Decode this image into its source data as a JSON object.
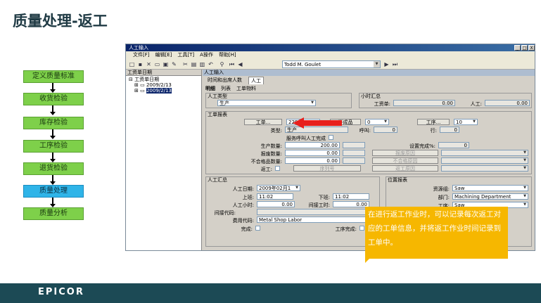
{
  "slide": {
    "title": "质量处理-返工",
    "footer_logo": "EPICOR"
  },
  "flow": {
    "steps": [
      "定义质量标准",
      "收货检验",
      "库存检验",
      "工序检验",
      "退货检验",
      "质量处理",
      "质量分析"
    ],
    "active": "质量处理"
  },
  "window": {
    "title": "人工输入",
    "controls": [
      "_",
      "□",
      "X"
    ],
    "menu": [
      "文件[F]",
      "编辑[E]",
      "工具[T]",
      "A操作",
      "帮助[H]"
    ],
    "user": "Todd M. Goulet",
    "left_header": "工资单日期",
    "tree": [
      "工资单日期",
      "2009/2/13",
      "2009/2/13"
    ],
    "main_header": "人工输入",
    "tabs": [
      "时间和出席人数",
      "人工"
    ],
    "subtabs": [
      "明细",
      "列表",
      "工单物料"
    ],
    "labor_type": {
      "label": "人工类型",
      "value": "生产"
    },
    "hour_summary": {
      "label": "小时汇总",
      "payroll_label": "工资单:",
      "payroll_value": "0.00",
      "labor_label": "人工:",
      "labor_value": "0.00"
    },
    "work_order": {
      "group": "工单报表",
      "job_btn": "工单...",
      "job_value": "2292",
      "part_btn": "半成品",
      "part_value": "0",
      "op_btn": "工序...",
      "op_value": "10",
      "type_label": "类型:",
      "type_value": "生产",
      "call_label": "呼叫:",
      "call_value": "0",
      "line_label": "行:",
      "line_value": "0",
      "service_label": "服务呼叫人工完成",
      "prod_qty_label": "生产数量:",
      "prod_qty": "200.00",
      "scrap_qty_label": "报废数量:",
      "scrap_qty": "0.00",
      "nonconf_label": "不合格品数量:",
      "nonconf_qty": "0.00",
      "rework_label": "返工:",
      "seq_btn": "序列号",
      "setup_label": "设置完成%:",
      "setup_value": "0",
      "scrap_reason_btn": "报废原因",
      "nonconf_reason_btn": "不合格原因",
      "rework_reason_btn": "返工原因"
    },
    "labor_summary": {
      "group": "人工汇总",
      "date_label": "人工日期:",
      "date_value": "2009年02月1",
      "start_label": "上班:",
      "start_value": "11:02",
      "end_label": "下班:",
      "end_value": "11:02",
      "labor_hr_label": "人工小时:",
      "labor_hr": "0.00",
      "burden_hr_label": "间接工时:",
      "burden_hr": "0.00",
      "indirect_label": "间接代码:",
      "expense_label": "费用代码:",
      "expense_value": "Metal Shop Labor",
      "complete_label": "完成:",
      "op_complete_label": "工序完成:"
    },
    "location": {
      "group": "位置报表",
      "resgrp_label": "资源组:",
      "resgrp_value": "Saw",
      "dept_label": "部门:",
      "dept_value": "Machining Department",
      "op_label": "工序:",
      "op_value": "Saw"
    }
  },
  "callout": "在进行返工作业时，可以记录每次返工对应的工单信息，并将返工作业时间记录到工单中。",
  "colors": {
    "accent": "#f6b700",
    "footer": "#1c4a55",
    "flow_step": "#7ed04a",
    "flow_active": "#2fb4e8",
    "arrow": "#e8201c"
  }
}
